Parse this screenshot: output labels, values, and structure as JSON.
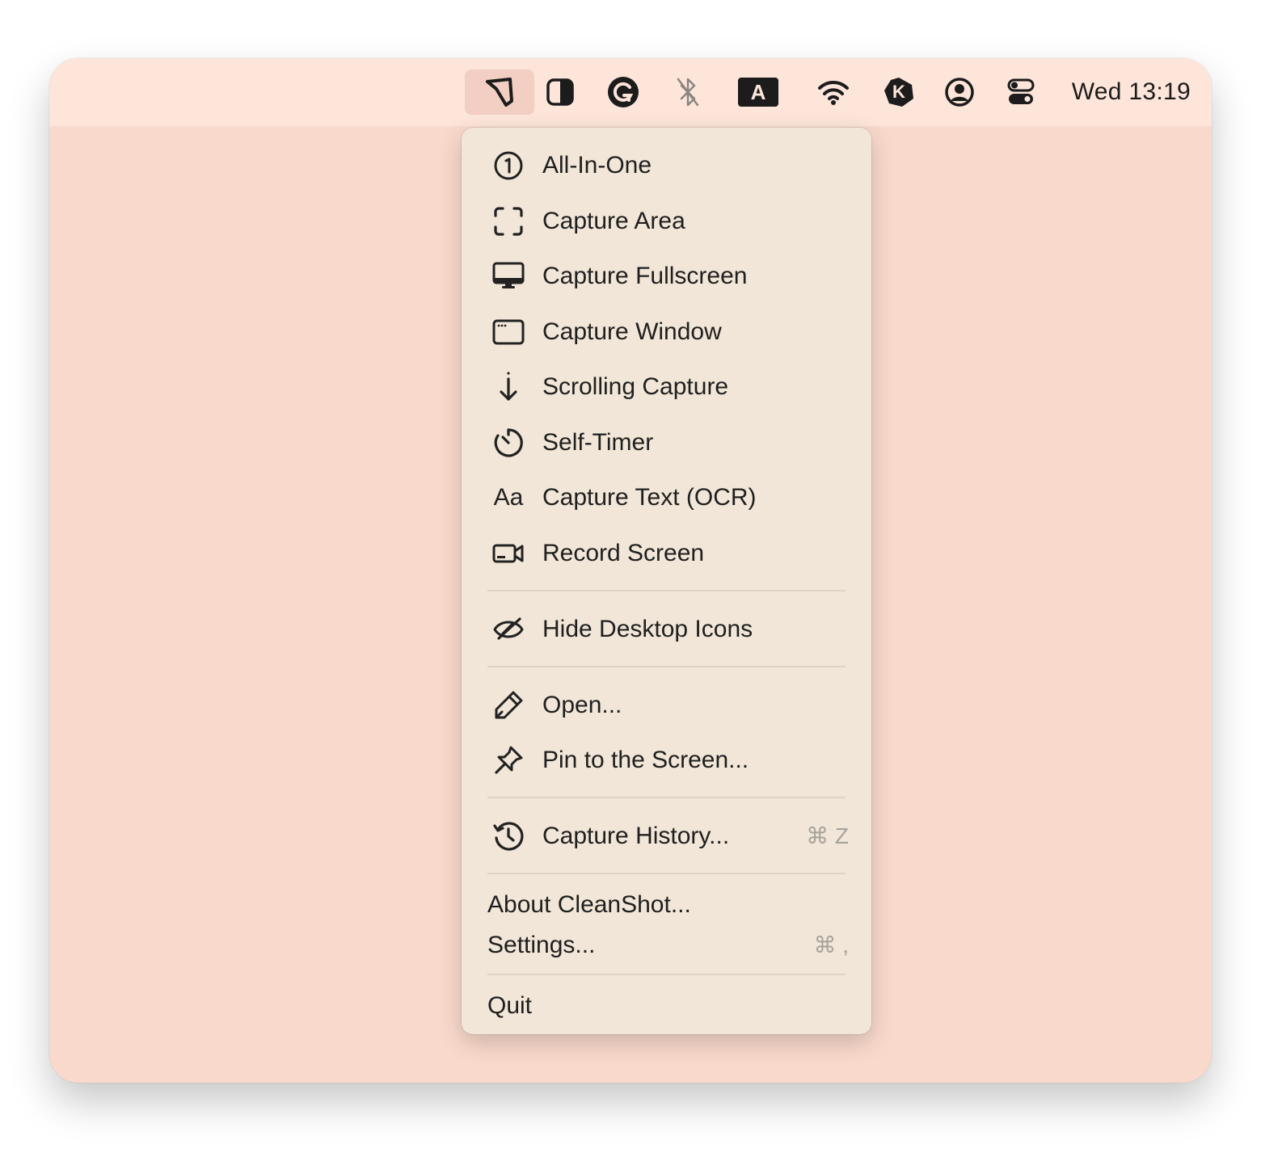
{
  "menubar": {
    "icons": [
      {
        "name": "cleanshot-icon",
        "active": true
      },
      {
        "name": "contrast-icon"
      },
      {
        "name": "grammarly-icon"
      },
      {
        "name": "bluetooth-off-icon"
      },
      {
        "name": "input-source-icon",
        "text": "A"
      },
      {
        "name": "wifi-icon"
      },
      {
        "name": "keyboard-maestro-icon",
        "text": "K"
      },
      {
        "name": "user-account-icon"
      },
      {
        "name": "control-center-icon"
      }
    ],
    "clock": "Wed 13:19"
  },
  "menu": {
    "items": [
      {
        "icon": "circled-one-icon",
        "label": "All-In-One"
      },
      {
        "icon": "capture-area-icon",
        "label": "Capture Area"
      },
      {
        "icon": "monitor-icon",
        "label": "Capture Fullscreen"
      },
      {
        "icon": "window-icon",
        "label": "Capture Window"
      },
      {
        "icon": "arrow-down-icon",
        "label": "Scrolling Capture"
      },
      {
        "icon": "timer-icon",
        "label": "Self-Timer"
      },
      {
        "icon": "text-aa-icon",
        "icon_text": "Aa",
        "label": "Capture Text (OCR)"
      },
      {
        "icon": "video-camera-icon",
        "label": "Record Screen"
      },
      {
        "icon": "eye-slash-icon",
        "label": "Hide Desktop Icons"
      },
      {
        "icon": "pencil-icon",
        "label": "Open..."
      },
      {
        "icon": "pin-icon",
        "label": "Pin to the Screen..."
      },
      {
        "icon": "history-icon",
        "label": "Capture History...",
        "shortcut": "⌘ Z"
      },
      {
        "label": "About CleanShot..."
      },
      {
        "label": "Settings...",
        "shortcut": "⌘ ,"
      },
      {
        "label": "Quit"
      }
    ]
  },
  "colors": {
    "desktop": "#f9d9cb",
    "menubar": "#fde5da",
    "menubar_active": "#f2cfc2",
    "menu_background": "#f1e6d8",
    "text": "#1f1f1f",
    "shortcut_text": "#a7a39c"
  }
}
